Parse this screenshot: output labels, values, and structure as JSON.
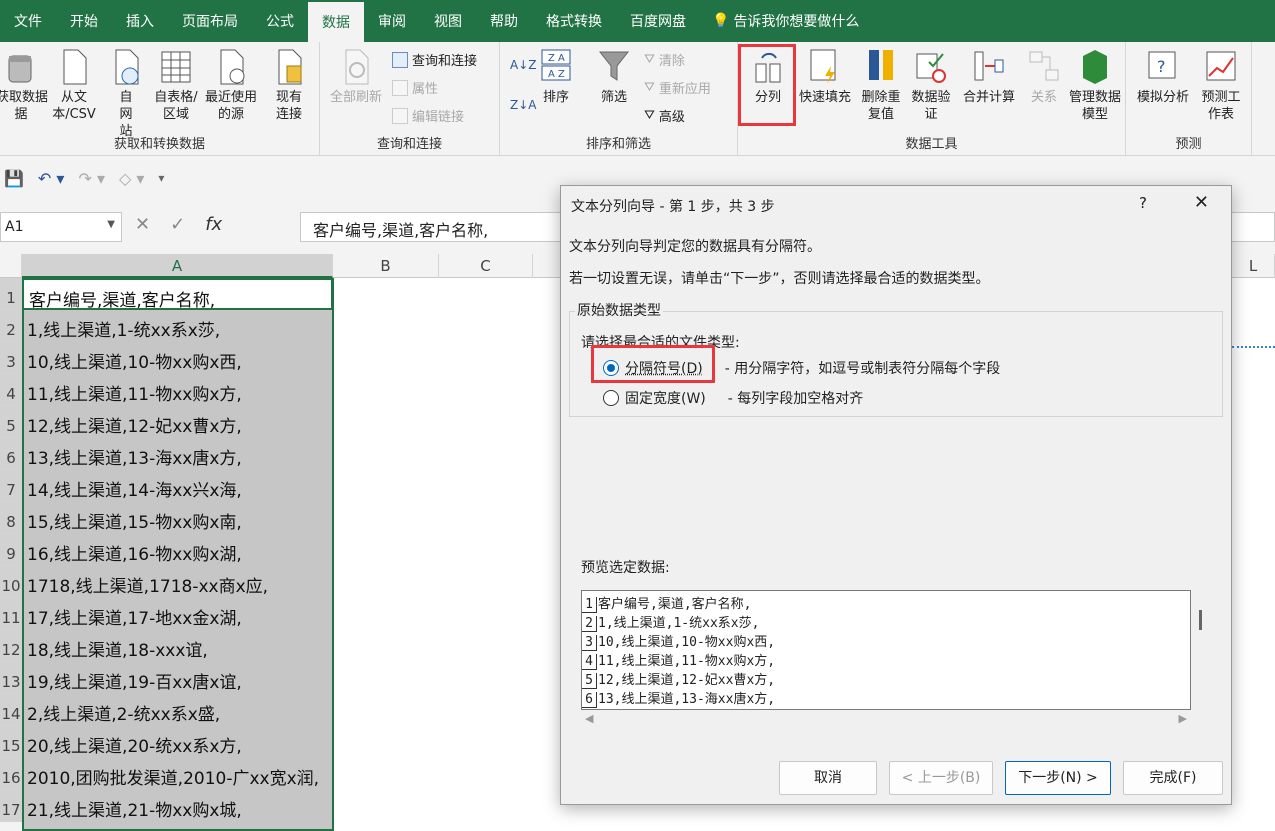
{
  "ribbon_tabs": [
    "文件",
    "开始",
    "插入",
    "页面布局",
    "公式",
    "数据",
    "审阅",
    "视图",
    "帮助",
    "格式转换",
    "百度网盘"
  ],
  "active_tab": "数据",
  "tell_me": "告诉我你想要做什么",
  "ribbon": {
    "get_data": "获取数据",
    "get_data_2": "据",
    "from_text": "从文本/CSV",
    "from_web": "自网站",
    "from_table": "自表格/区域",
    "recent": "最近使用的源",
    "existing": "现有连接",
    "group_get": "获取和转换数据",
    "refresh_all": "全部刷新",
    "queries": "查询和连接",
    "properties": "属性",
    "edit_links": "编辑链接",
    "group_queries": "查询和连接",
    "sort": "排序",
    "filter": "筛选",
    "clear": "清除",
    "reapply": "重新应用",
    "advanced": "高级",
    "group_sort": "排序和筛选",
    "split": "分列",
    "flash_fill": "快速填充",
    "remove_dup": "删除重复值",
    "validation": "数据验证",
    "consolidate": "合并计算",
    "relations": "关系",
    "data_model": "管理数据模型",
    "group_tools": "数据工具",
    "whatif": "模拟分析",
    "forecast": "预测工作表",
    "group_forecast": "预测"
  },
  "namebox": "A1",
  "formula": "客户编号,渠道,客户名称,",
  "columns": [
    "A",
    "B",
    "C",
    "L"
  ],
  "rows": [
    "1",
    "2",
    "3",
    "4",
    "5",
    "6",
    "7",
    "8",
    "9",
    "10",
    "11",
    "12",
    "13",
    "14",
    "15",
    "16",
    "17"
  ],
  "cells": [
    "客户编号,渠道,客户名称,",
    "1,线上渠道,1-统xx系x莎,",
    "10,线上渠道,10-物xx购x西,",
    "11,线上渠道,11-物xx购x方,",
    "12,线上渠道,12-妃xx曹x方,",
    "13,线上渠道,13-海xx唐x方,",
    "14,线上渠道,14-海xx兴x海,",
    "15,线上渠道,15-物xx购x南,",
    "16,线上渠道,16-物xx购x湖,",
    "1718,线上渠道,1718-xx商x应,",
    "17,线上渠道,17-地xx金x湖,",
    "18,线上渠道,18-xxx谊,",
    "19,线上渠道,19-百xx唐x谊,",
    "2,线上渠道,2-统xx系x盛,",
    "20,线上渠道,20-统xx系x方,",
    "2010,团购批发渠道,2010-广xx宽x润,",
    "21,线上渠道,21-物xx购x城,"
  ],
  "dialog": {
    "title": "文本分列向导 - 第 1 步，共 3 步",
    "help": "?",
    "close": "✕",
    "line1": "文本分列向导判定您的数据具有分隔符。",
    "line2": "若一切设置无误，请单击“下一步”，否则请选择最合适的数据类型。",
    "group_title": "原始数据类型",
    "choose": "请选择最合适的文件类型:",
    "opt1": "分隔符号(D)",
    "opt1_desc": "- 用分隔字符，如逗号或制表符分隔每个字段",
    "opt2": "固定宽度(W)",
    "opt2_desc": "- 每列字段加空格对齐",
    "preview_label": "预览选定数据:",
    "preview": [
      {
        "n": "1",
        "t": "客户编号,渠道,客户名称,"
      },
      {
        "n": "2",
        "t": "1,线上渠道,1-统xx系x莎,"
      },
      {
        "n": "3",
        "t": "10,线上渠道,10-物xx购x西,"
      },
      {
        "n": "4",
        "t": "11,线上渠道,11-物xx购x方,"
      },
      {
        "n": "5",
        "t": "12,线上渠道,12-妃xx曹x方,"
      },
      {
        "n": "6",
        "t": "13,线上渠道,13-海xx唐x方,"
      }
    ],
    "cancel": "取消",
    "back": "< 上一步(B)",
    "next": "下一步(N) >",
    "finish": "完成(F)"
  }
}
